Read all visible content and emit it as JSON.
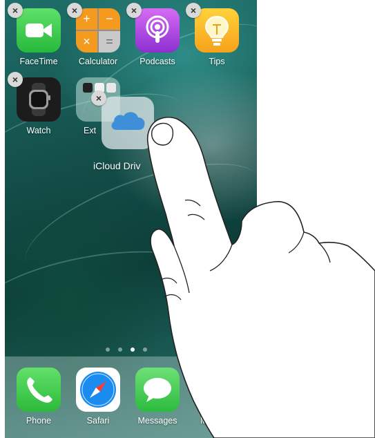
{
  "home_screen": {
    "apps_row1": [
      {
        "label": "FaceTime",
        "icon": "facetime-icon"
      },
      {
        "label": "Calculator",
        "icon": "calculator-icon"
      },
      {
        "label": "Podcasts",
        "icon": "podcasts-icon"
      },
      {
        "label": "Tips",
        "icon": "tips-icon"
      }
    ],
    "apps_row2": [
      {
        "label": "Watch",
        "icon": "watch-icon"
      },
      {
        "label": "Ext",
        "icon": "folder-icon"
      }
    ],
    "dragged_app": {
      "label": "iCloud Driv",
      "icon": "icloud-drive-icon"
    },
    "delete_glyph": "×",
    "calculator_keys": [
      "+",
      "−",
      "×",
      "="
    ]
  },
  "page_dots": {
    "count": 4,
    "active_index": 2
  },
  "dock": {
    "apps": [
      {
        "label": "Phone",
        "icon": "phone-icon"
      },
      {
        "label": "Safari",
        "icon": "safari-icon"
      },
      {
        "label": "Messages",
        "icon": "messages-icon"
      },
      {
        "label": "M",
        "icon": "music-icon"
      }
    ]
  },
  "colors": {
    "facetime": "#27b93b",
    "calculator_orange": "#f39a1f",
    "podcasts": "#8d2fd0",
    "tips": "#f7a21b",
    "icloud_blue": "#3f8fd8"
  }
}
